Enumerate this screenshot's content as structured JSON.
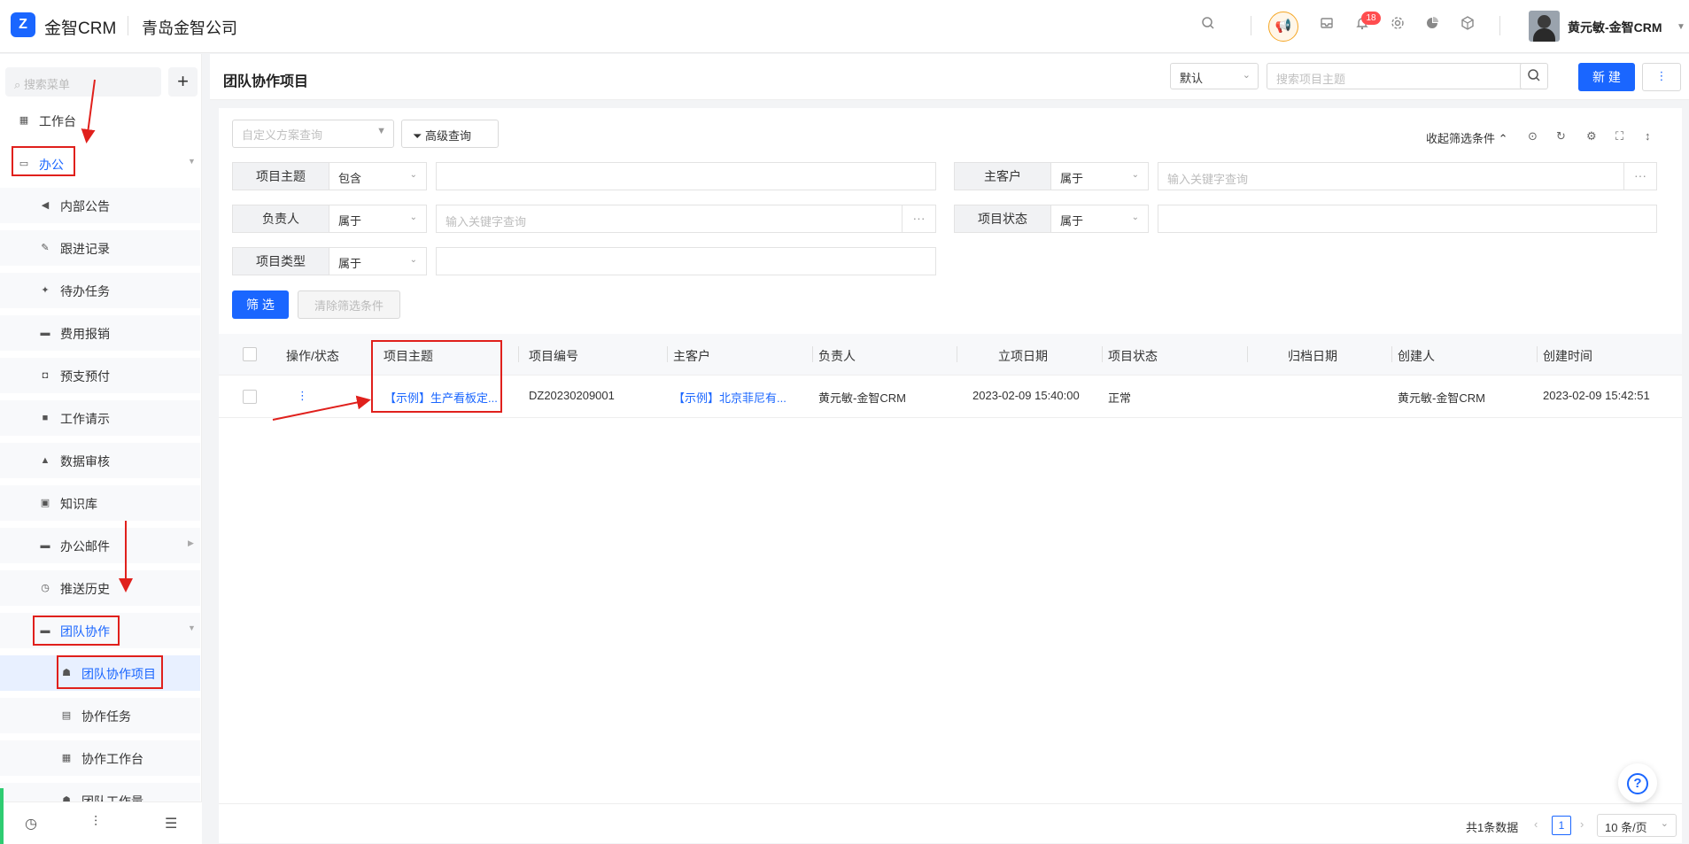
{
  "app": {
    "logo_text": "金智CRM",
    "company": "青岛金智公司",
    "notification_count": "18",
    "user_name": "黄元敏-金智CRM"
  },
  "sidebar": {
    "search_placeholder": "搜索菜单",
    "add_label": "+",
    "items": [
      {
        "label": "工作台",
        "icon": "dashboard-icon"
      },
      {
        "label": "办公",
        "icon": "laptop-icon"
      },
      {
        "label": "内部公告",
        "icon": "megaphone-icon"
      },
      {
        "label": "跟进记录",
        "icon": "edit-icon"
      },
      {
        "label": "待办任务",
        "icon": "pin-icon"
      },
      {
        "label": "费用报销",
        "icon": "card-icon"
      },
      {
        "label": "预支预付",
        "icon": "wallet-icon"
      },
      {
        "label": "工作请示",
        "icon": "message-icon"
      },
      {
        "label": "数据审核",
        "icon": "stamp-icon"
      },
      {
        "label": "知识库",
        "icon": "book-icon"
      },
      {
        "label": "办公邮件",
        "icon": "folder-icon"
      },
      {
        "label": "推送历史",
        "icon": "clock-icon"
      },
      {
        "label": "团队协作",
        "icon": "folder-open-icon"
      },
      {
        "label": "团队协作项目",
        "icon": "team-icon"
      },
      {
        "label": "协作任务",
        "icon": "task-icon"
      },
      {
        "label": "协作工作台",
        "icon": "dashboard-icon"
      },
      {
        "label": "团队工作量",
        "icon": "team-icon"
      }
    ]
  },
  "header": {
    "title": "团队协作项目",
    "view_select": "默认",
    "search_placeholder": "搜索项目主题",
    "new_button": "新 建",
    "more_button": "⋮"
  },
  "filters": {
    "scheme_placeholder": "自定义方案查询",
    "advanced_button": "高级查询",
    "collapse_label": "收起筛选条件",
    "rows": [
      {
        "label": "项目主题",
        "op": "包含",
        "value": ""
      },
      {
        "label": "主客户",
        "op": "属于",
        "value": "输入关键字查询"
      },
      {
        "label": "负责人",
        "op": "属于",
        "value": "输入关键字查询"
      },
      {
        "label": "项目状态",
        "op": "属于",
        "value": ""
      },
      {
        "label": "项目类型",
        "op": "属于",
        "value": ""
      }
    ],
    "filter_button": "筛 选",
    "clear_button": "清除筛选条件"
  },
  "table": {
    "columns": [
      "操作/状态",
      "项目主题",
      "项目编号",
      "主客户",
      "负责人",
      "立项日期",
      "项目状态",
      "归档日期",
      "创建人",
      "创建时间"
    ],
    "rows": [
      {
        "action": "⋮",
        "subject": "【示例】生产看板定...",
        "code": "DZ20230209001",
        "customer": "【示例】北京菲尼有...",
        "owner": "黄元敏-金智CRM",
        "start_date": "2023-02-09 15:40:00",
        "status": "正常",
        "archive_date": "",
        "creator": "黄元敏-金智CRM",
        "created": "2023-02-09 15:42:51"
      }
    ]
  },
  "pagination": {
    "total": "共1条数据",
    "page": "1",
    "page_size": "10 条/页"
  },
  "help": {
    "label": "?"
  }
}
